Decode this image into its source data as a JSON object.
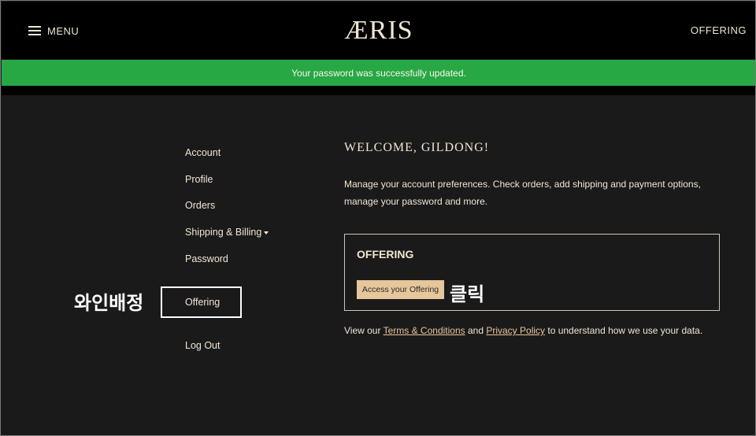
{
  "header": {
    "menu_label": "MENU",
    "logo": "ÆRIS",
    "offering_link": "OFFERING"
  },
  "banner": {
    "message": "Your password was successfully updated.",
    "color": "#28a745"
  },
  "sidebar": {
    "items": [
      {
        "label": "Account"
      },
      {
        "label": "Profile"
      },
      {
        "label": "Orders"
      },
      {
        "label": "Shipping & Billing"
      },
      {
        "label": "Password"
      },
      {
        "label": "Offering"
      },
      {
        "label": "Log Out"
      }
    ]
  },
  "annotations": {
    "left": "와인배정",
    "right": "클릭"
  },
  "main": {
    "welcome": "WELCOME, GILDONG!",
    "description": "Manage your account preferences. Check orders, add shipping and payment options, manage your password and more.",
    "offering_card": {
      "title": "OFFERING",
      "button_label": "Access your Offering"
    },
    "legal": {
      "prefix": "View our ",
      "terms": "Terms & Conditions",
      "middle": " and ",
      "privacy": "Privacy Policy",
      "suffix": " to understand how we use your data."
    }
  },
  "colors": {
    "background": "#1b1a1a",
    "header_bg": "#000000",
    "text": "#f0e6d2",
    "accent": "#e6c79b"
  }
}
